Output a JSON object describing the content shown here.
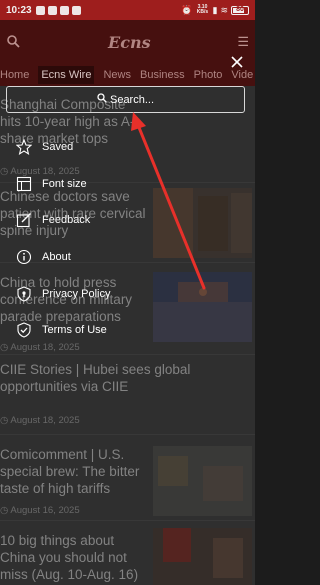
{
  "status_bar": {
    "time": "10:23",
    "network_speed": "3.10 KB/s",
    "battery": "80"
  },
  "app": {
    "logo": "Ecns"
  },
  "tabs": [
    "Home",
    "Ecns Wire",
    "News",
    "Business",
    "Photo",
    "Vide"
  ],
  "active_tab_index": 1,
  "feed": [
    {
      "title": "Shanghai Composite hits 10-year high as A-share market tops",
      "date": "August 18, 2025"
    },
    {
      "title": "Chinese doctors save patient with rare cervical spine injury",
      "date": ""
    },
    {
      "title": "China to hold press conference on military parade preparations",
      "date": "August 18, 2025"
    },
    {
      "title": "CIIE Stories | Hubei sees global opportunities via CIIE",
      "date": "August 18, 2025"
    },
    {
      "title": "Comicomment | U.S. special brew: The bitter taste of high tariffs",
      "date": "August 16, 2025"
    },
    {
      "title": "10 big things about China you should not miss (Aug. 10-Aug. 16)",
      "date": ""
    }
  ],
  "overlay": {
    "search_placeholder": "Search...",
    "menu": [
      {
        "label": "Saved",
        "icon": "star-icon"
      },
      {
        "label": "Font size",
        "icon": "font-size-icon"
      },
      {
        "label": "Feedback",
        "icon": "feedback-icon"
      },
      {
        "label": "About",
        "icon": "info-icon"
      },
      {
        "label": "Privacy Policy",
        "icon": "shield-icon"
      },
      {
        "label": "Terms of Use",
        "icon": "shield-check-icon"
      }
    ]
  },
  "colors": {
    "brand_red": "#a7201f",
    "arrow_red": "#e8302a"
  }
}
